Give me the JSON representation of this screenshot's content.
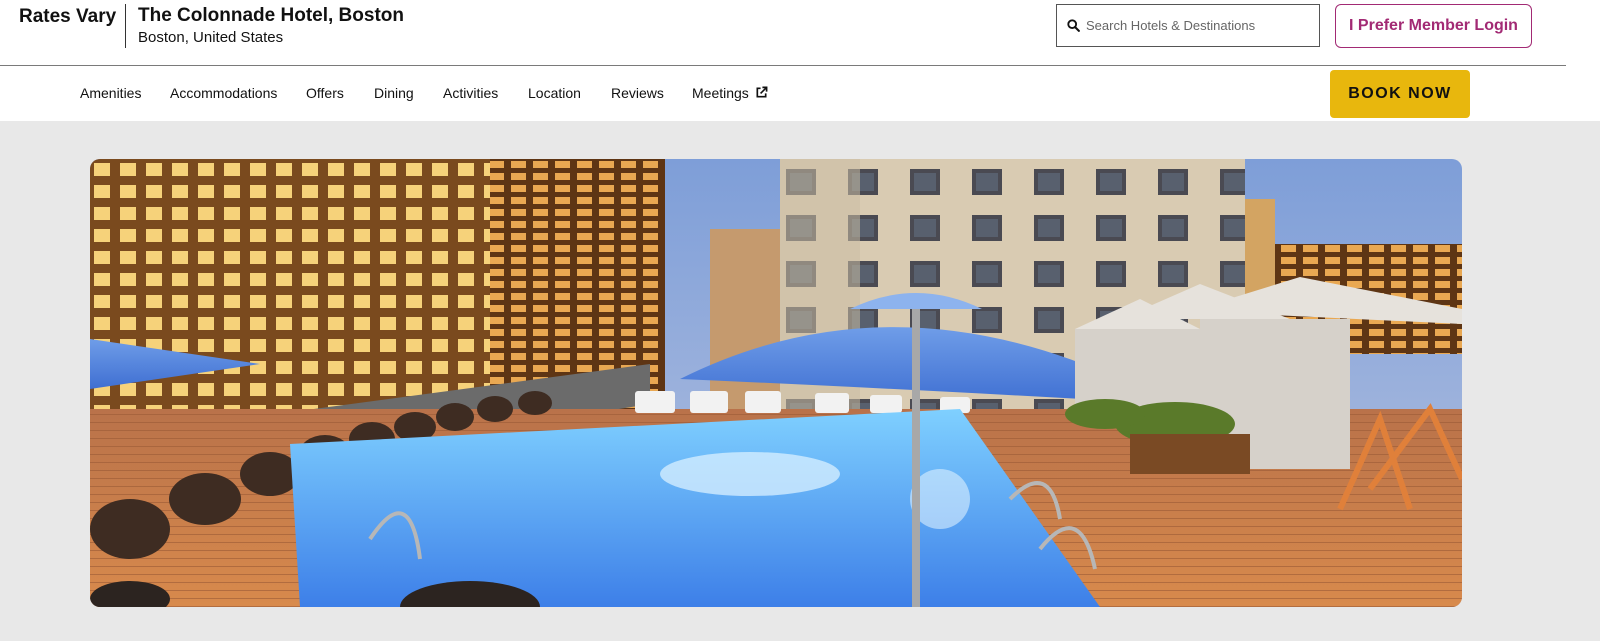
{
  "header": {
    "rates_label": "Rates Vary",
    "hotel_name": "The Colonnade Hotel, Boston",
    "hotel_location": "Boston, United States",
    "search_placeholder": "Search Hotels & Destinations",
    "login_label": "I Prefer Member Login"
  },
  "nav": {
    "items": [
      "Amenities",
      "Accommodations",
      "Offers",
      "Dining",
      "Activities",
      "Location",
      "Reviews",
      "Meetings"
    ],
    "meetings_icon": "external-link-icon",
    "book_label": "BOOK NOW"
  },
  "colors": {
    "accent_magenta": "#a22a74",
    "book_button": "#e8b70d",
    "hero_background": "#e8e8e8"
  },
  "hero": {
    "icon": "rooftop-pool-photo"
  }
}
